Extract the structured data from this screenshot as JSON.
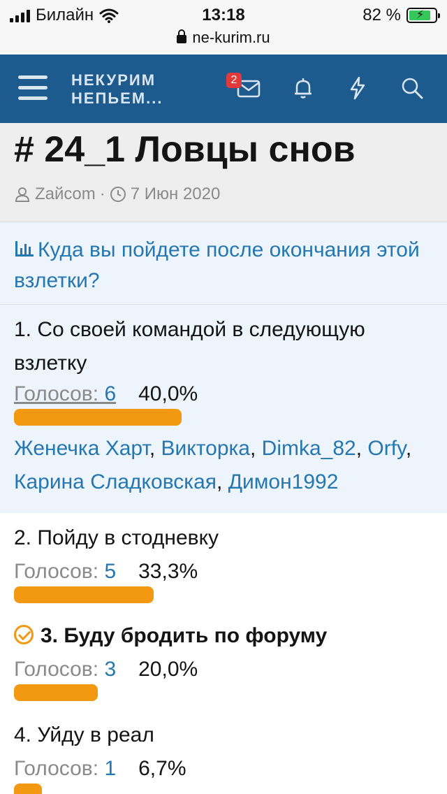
{
  "status": {
    "carrier": "Билайн",
    "time": "13:18",
    "battery": "82 %",
    "battery_level": 0.82
  },
  "browser": {
    "url": "ne-kurim.ru"
  },
  "nav": {
    "logo_line1": "НЕКУРИМ",
    "logo_line2": "НЕПЬЕМ...",
    "messages_badge": "2"
  },
  "thread": {
    "title": "# 24_1 Ловцы снов",
    "author": "Zaйcom",
    "separator": "·",
    "date": "7 Июн 2020"
  },
  "poll": {
    "question": "Куда вы пойдете после окончания этой взлетки?",
    "options": [
      {
        "label": "1. Со своей командой в следующую взлетку",
        "votes_label": "Голосов:",
        "votes": "6",
        "percent": "40,0%",
        "fraction": 0.4
      },
      {
        "label": "2. Пойду в стодневку",
        "votes_label": "Голосов:",
        "votes": "5",
        "percent": "33,3%",
        "fraction": 0.333
      },
      {
        "label": "3. Буду бродить по форуму",
        "votes_label": "Голосов:",
        "votes": "3",
        "percent": "20,0%",
        "fraction": 0.2
      },
      {
        "label": "4. Уйду в реал",
        "votes_label": "Голосов:",
        "votes": "1",
        "percent": "6,7%",
        "fraction": 0.067
      }
    ],
    "voters": [
      "Женечка Харт",
      "Викторка",
      "Dimka_82",
      "Orfy",
      "Карина Сладковская",
      "Димон1992"
    ]
  },
  "colors": {
    "nav": "#1d5b8f",
    "link": "#2577b1",
    "bar": "#f39811",
    "poll_bg": "#edf4fb"
  }
}
